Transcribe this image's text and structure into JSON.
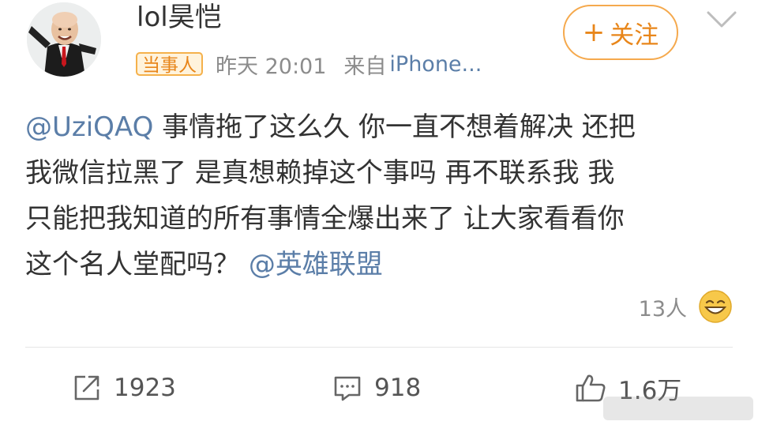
{
  "header": {
    "username": "lol昊恺",
    "badge": "当事人",
    "time": "昨天 20:01",
    "source_prefix": "来自",
    "source": "iPhone...",
    "follow_label": "关注",
    "follow_icon": "plus-icon"
  },
  "post": {
    "lines": [
      {
        "mention": "@UziQAQ",
        "text": " 事情拖了这么久 你一直不想着解决 还把"
      },
      {
        "text": "我微信拉黑了 是真想赖掉这个事吗 再不联系我 我"
      },
      {
        "text": "只能把我知道的所有事情全爆出来了 让大家看看你"
      },
      {
        "text": "这个名人堂配吗？ ",
        "mention": "@英雄联盟"
      }
    ]
  },
  "reaction": {
    "count": "13人",
    "icon": "laughing-emoji-icon"
  },
  "actions": {
    "repost": {
      "count": "1923",
      "icon": "share-icon"
    },
    "comment": {
      "count": "918",
      "icon": "comment-icon"
    },
    "like": {
      "count": "1.6万",
      "icon": "thumbs-up-icon"
    }
  },
  "colors": {
    "accent_orange": "#e8861a",
    "link_blue": "#5b7ea8",
    "secondary_text": "#8c8c8c"
  }
}
